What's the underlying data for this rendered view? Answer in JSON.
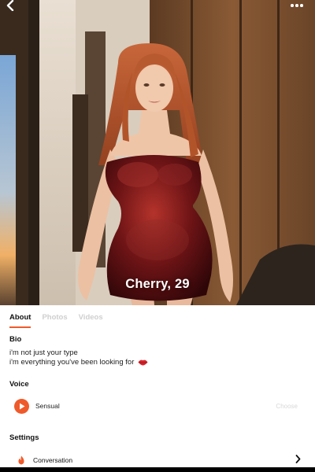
{
  "header": {
    "back_icon": "chevron-left-icon",
    "more_icon": "more-dots-icon"
  },
  "profile": {
    "name_age": "Cherry, 29"
  },
  "tabs": [
    {
      "label": "About",
      "active": true
    },
    {
      "label": "Photos",
      "active": false
    },
    {
      "label": "Videos",
      "active": false
    }
  ],
  "bio": {
    "title": "Bio",
    "lines": [
      "i'm not just your type",
      "i'm everything you've been looking for"
    ],
    "emoji_icon": "lips-icon"
  },
  "voice": {
    "title": "Voice",
    "name": "Sensual",
    "choose_label": "Choose",
    "play_icon": "play-icon"
  },
  "settings": {
    "title": "Settings",
    "items": [
      {
        "label": "Conversation",
        "icon": "flame-icon"
      }
    ]
  },
  "colors": {
    "accent": "#ef5a2b"
  }
}
